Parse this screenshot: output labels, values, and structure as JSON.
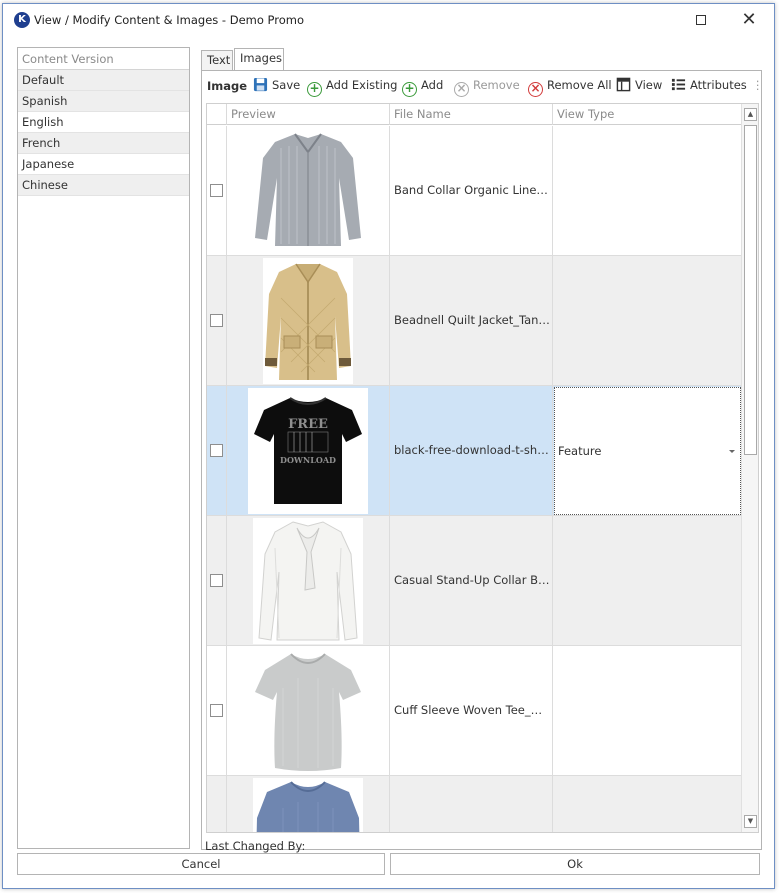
{
  "window": {
    "title": "View / Modify Content & Images - Demo Promo",
    "app_icon": "app-logo-icon",
    "maximize": "maximize-icon",
    "close_glyph": "✕"
  },
  "content_versions": {
    "header": "Content Version",
    "items": [
      "Default",
      "Spanish",
      "English",
      "French",
      "Japanese",
      "Chinese"
    ]
  },
  "tabs": [
    {
      "label": "Text"
    },
    {
      "label": "Images"
    }
  ],
  "toolbar": {
    "title": "Image",
    "save": "Save",
    "add_existing": "Add Existing",
    "add": "Add",
    "remove": "Remove",
    "remove_all": "Remove All",
    "view": "View",
    "attributes": "Attributes"
  },
  "grid": {
    "columns": {
      "preview": "Preview",
      "file_name": "File Name",
      "view_type": "View Type"
    },
    "rows": [
      {
        "file_name": "Band Collar Organic Linen Blouse",
        "view_type": "",
        "image": "grey-linen-blouse"
      },
      {
        "file_name": "Beadnell Quilt Jacket_Tan.JPG",
        "view_type": "",
        "image": "tan-quilt-jacket"
      },
      {
        "file_name": "black-free-download-t-shirts-",
        "view_type": "Feature",
        "image": "black-free-download-tshirt"
      },
      {
        "file_name": "Casual Stand-Up Collar Blouse",
        "view_type": "",
        "image": "white-bow-blouse"
      },
      {
        "file_name": "Cuff Sleeve Woven Tee_Graphite",
        "view_type": "",
        "image": "grey-woven-tee"
      },
      {
        "file_name": "",
        "view_type": "",
        "image": "blue-long-sleeve-tee"
      }
    ],
    "tshirt_print": [
      "FREE",
      "DOWNLOAD"
    ]
  },
  "footer": {
    "last_changed_label": "Last Changed By:",
    "cancel": "Cancel",
    "ok": "Ok"
  },
  "colors": {
    "selected_row": "#cfe3f6",
    "alt_row": "#efefef",
    "add_green": "#3a9a3a",
    "remove_red": "#d23b3b",
    "save_blue": "#2e72b8"
  }
}
